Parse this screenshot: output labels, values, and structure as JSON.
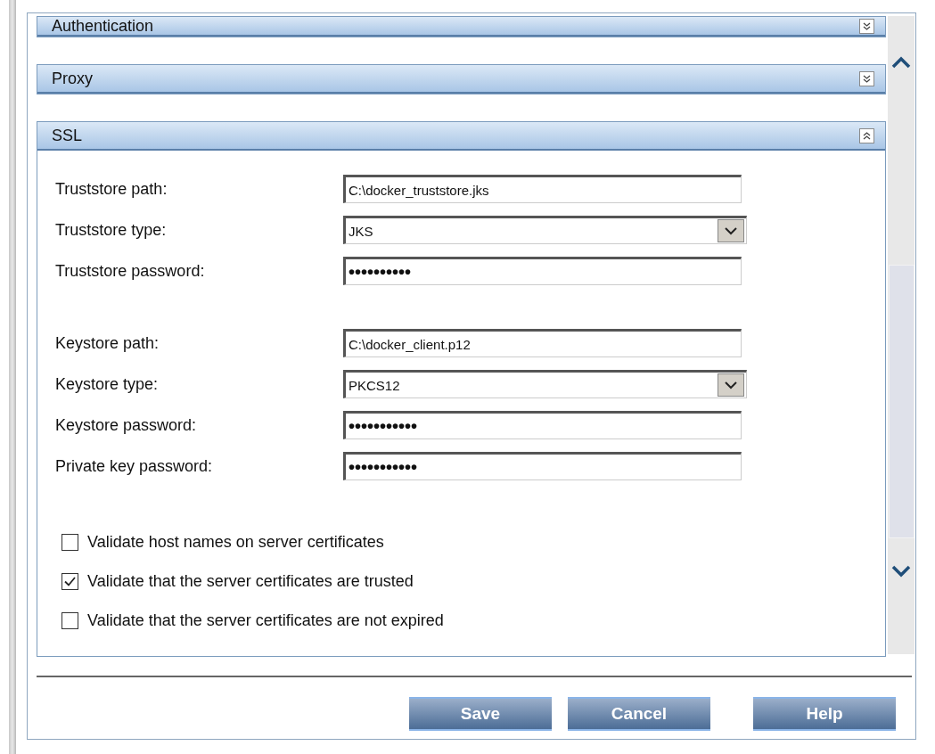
{
  "sections": [
    {
      "title": "Authentication",
      "expanded": false
    },
    {
      "title": "Proxy",
      "expanded": false
    },
    {
      "title": "SSL",
      "expanded": true
    }
  ],
  "fields": [
    {
      "label": "Truststore path:",
      "kind": "text",
      "value": "C:\\docker_truststore.jks"
    },
    {
      "label": "Truststore type:",
      "kind": "select",
      "value": "JKS"
    },
    {
      "label": "Truststore password:",
      "kind": "password",
      "value": "••••••••••"
    },
    {
      "label": "Keystore path:",
      "kind": "text",
      "value": "C:\\docker_client.p12",
      "gap": true
    },
    {
      "label": "Keystore type:",
      "kind": "select",
      "value": "PKCS12"
    },
    {
      "label": "Keystore password:",
      "kind": "password",
      "value": "•••••••••••"
    },
    {
      "label": "Private key password:",
      "kind": "password",
      "value": "•••••••••••"
    }
  ],
  "checkboxes": [
    {
      "label": "Validate host names on server certificates",
      "checked": false
    },
    {
      "label": "Validate that the server certificates are trusted",
      "checked": true
    },
    {
      "label": "Validate that the server certificates are not expired",
      "checked": false
    }
  ],
  "buttons": [
    "Save",
    "Cancel",
    "Help"
  ]
}
